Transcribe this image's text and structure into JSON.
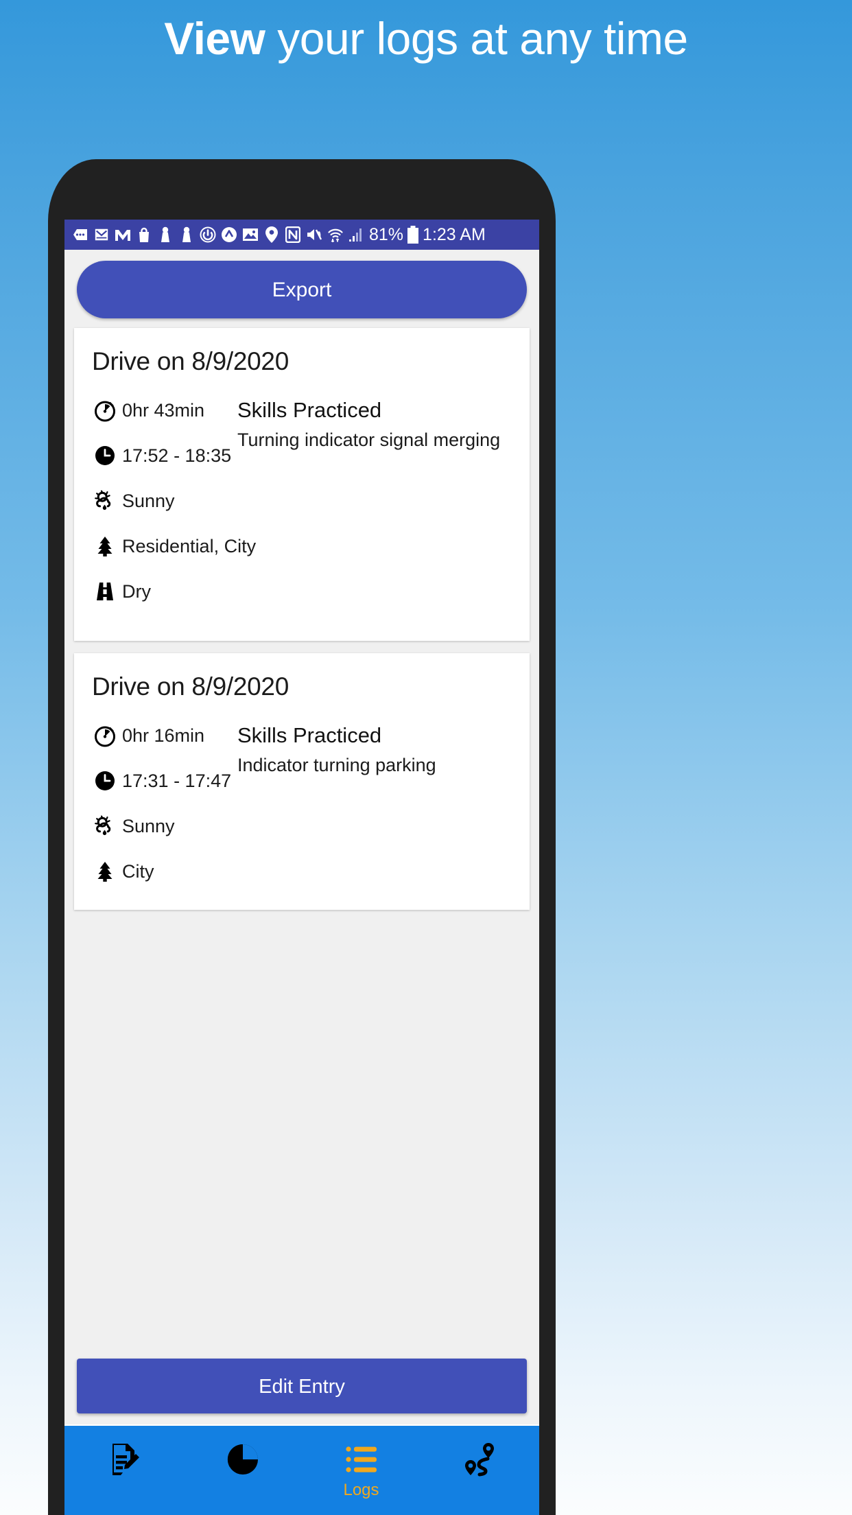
{
  "headline": {
    "bold": "View",
    "light": " your logs at any time"
  },
  "statusbar": {
    "icons": [
      "more-notifications-icon",
      "email-icon",
      "gmail-icon",
      "shopping-bag-icon",
      "contact-icon",
      "contact-icon-2",
      "power-icon",
      "app-icon",
      "photos-icon",
      "location-icon",
      "nfc-icon",
      "mute-icon",
      "wifi-icon",
      "signal-icon"
    ],
    "battery_percent": "81%",
    "time": "1:23 AM"
  },
  "toolbar": {
    "export_label": "Export"
  },
  "cards": [
    {
      "title": "Drive on 8/9/2020",
      "duration": "0hr 43min",
      "timerange": "17:52 - 18:35",
      "weather": "Sunny",
      "area": "Residential, City",
      "road": "Dry",
      "skills_heading": "Skills Practiced",
      "skills_text": "Turning indicator signal merging"
    },
    {
      "title": "Drive on 8/9/2020",
      "duration": "0hr 16min",
      "timerange": "17:31 - 17:47",
      "weather": "Sunny",
      "area": "City",
      "skills_heading": "Skills Practiced",
      "skills_text": "Indicator turning parking"
    }
  ],
  "footer": {
    "edit_label": "Edit Entry"
  },
  "nav": {
    "items": [
      {
        "icon": "document-edit-icon",
        "label": ""
      },
      {
        "icon": "pie-chart-icon",
        "label": ""
      },
      {
        "icon": "list-icon",
        "label": "Logs"
      },
      {
        "icon": "route-icon",
        "label": ""
      }
    ],
    "active_index": 2,
    "active_color": "#f0a81e",
    "background": "#1380e2"
  },
  "colors": {
    "accent_button": "#4150b8",
    "statusbar": "#3b42a4",
    "page_top": "#3498db",
    "page_bottom": "#fbfdfe"
  }
}
